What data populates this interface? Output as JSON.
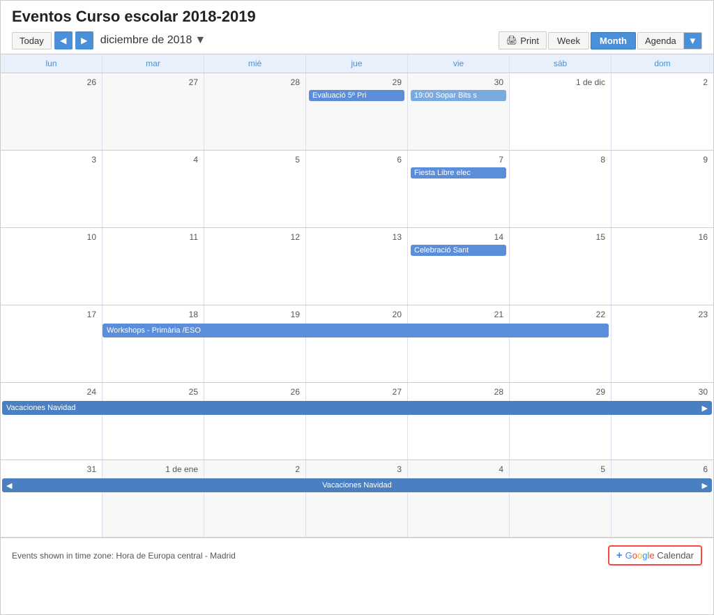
{
  "page": {
    "title": "Eventos Curso escolar 2018-2019"
  },
  "toolbar": {
    "today_label": "Today",
    "month_label": "diciembre de 2018",
    "print_label": "Print",
    "week_label": "Week",
    "month_view_label": "Month",
    "agenda_label": "Agenda"
  },
  "day_headers": [
    "lun",
    "mar",
    "mié",
    "jue",
    "vie",
    "sáb",
    "dom"
  ],
  "weeks": [
    {
      "days": [
        {
          "num": "26",
          "other": true,
          "events": []
        },
        {
          "num": "27",
          "other": true,
          "events": []
        },
        {
          "num": "28",
          "other": true,
          "events": []
        },
        {
          "num": "29",
          "other": true,
          "events": [
            {
              "label": "Evaluació 5º Pri",
              "color": "blue"
            }
          ]
        },
        {
          "num": "30",
          "other": true,
          "events": [
            {
              "label": "19:00 Sopar Bits s",
              "color": "light"
            }
          ]
        },
        {
          "num": "1 de dic",
          "other": false,
          "events": []
        },
        {
          "num": "2",
          "other": false,
          "events": []
        }
      ],
      "spanning": []
    },
    {
      "days": [
        {
          "num": "3",
          "other": false,
          "events": []
        },
        {
          "num": "4",
          "other": false,
          "events": []
        },
        {
          "num": "5",
          "other": false,
          "events": []
        },
        {
          "num": "6",
          "other": false,
          "events": []
        },
        {
          "num": "7",
          "other": false,
          "events": [
            {
              "label": "Fiesta Libre elec",
              "color": "blue"
            }
          ]
        },
        {
          "num": "8",
          "other": false,
          "events": []
        },
        {
          "num": "9",
          "other": false,
          "events": []
        }
      ],
      "spanning": []
    },
    {
      "days": [
        {
          "num": "10",
          "other": false,
          "events": []
        },
        {
          "num": "11",
          "other": false,
          "events": []
        },
        {
          "num": "12",
          "other": false,
          "events": []
        },
        {
          "num": "13",
          "other": false,
          "events": []
        },
        {
          "num": "14",
          "other": false,
          "events": [
            {
              "label": "Celebració Sant",
              "color": "blue"
            }
          ]
        },
        {
          "num": "15",
          "other": false,
          "events": []
        },
        {
          "num": "16",
          "other": false,
          "events": []
        }
      ],
      "spanning": []
    },
    {
      "days": [
        {
          "num": "17",
          "other": false,
          "events": []
        },
        {
          "num": "18",
          "other": false,
          "events": []
        },
        {
          "num": "19",
          "other": false,
          "events": []
        },
        {
          "num": "20",
          "other": false,
          "events": []
        },
        {
          "num": "21",
          "other": false,
          "events": []
        },
        {
          "num": "22",
          "other": false,
          "events": []
        },
        {
          "num": "23",
          "other": false,
          "events": []
        }
      ],
      "spanning": [
        {
          "label": "Workshops - Primària /ESO",
          "color": "blue",
          "startCol": 1,
          "endCol": 5
        }
      ]
    },
    {
      "days": [
        {
          "num": "24",
          "other": false,
          "events": []
        },
        {
          "num": "25",
          "other": false,
          "events": []
        },
        {
          "num": "26",
          "other": false,
          "events": []
        },
        {
          "num": "27",
          "other": false,
          "events": []
        },
        {
          "num": "28",
          "other": false,
          "events": []
        },
        {
          "num": "29",
          "other": false,
          "events": []
        },
        {
          "num": "30",
          "other": false,
          "events": []
        }
      ],
      "spanning": [
        {
          "label": "Vacaciones Navidad",
          "color": "blue-dark",
          "startCol": 0,
          "endCol": 6,
          "arrowRight": true
        }
      ]
    },
    {
      "days": [
        {
          "num": "31",
          "other": false,
          "events": []
        },
        {
          "num": "1 de ene",
          "other": true,
          "events": []
        },
        {
          "num": "2",
          "other": true,
          "events": []
        },
        {
          "num": "3",
          "other": true,
          "events": []
        },
        {
          "num": "4",
          "other": true,
          "events": []
        },
        {
          "num": "5",
          "other": true,
          "events": []
        },
        {
          "num": "6",
          "other": true,
          "events": []
        }
      ],
      "spanning": [
        {
          "label": "Vacaciones Navidad",
          "color": "blue-dark",
          "startCol": 0,
          "endCol": 6,
          "arrowLeft": true,
          "arrowRight": true
        }
      ]
    }
  ],
  "footer": {
    "timezone_text": "Events shown in time zone: Hora de Europa central - Madrid",
    "google_calendar_label": "Google Calendar"
  },
  "colors": {
    "blue": "#5b8dd9",
    "blue_dark": "#4a7fc1",
    "light_blue": "#7baae0",
    "accent": "#4a90d9"
  }
}
